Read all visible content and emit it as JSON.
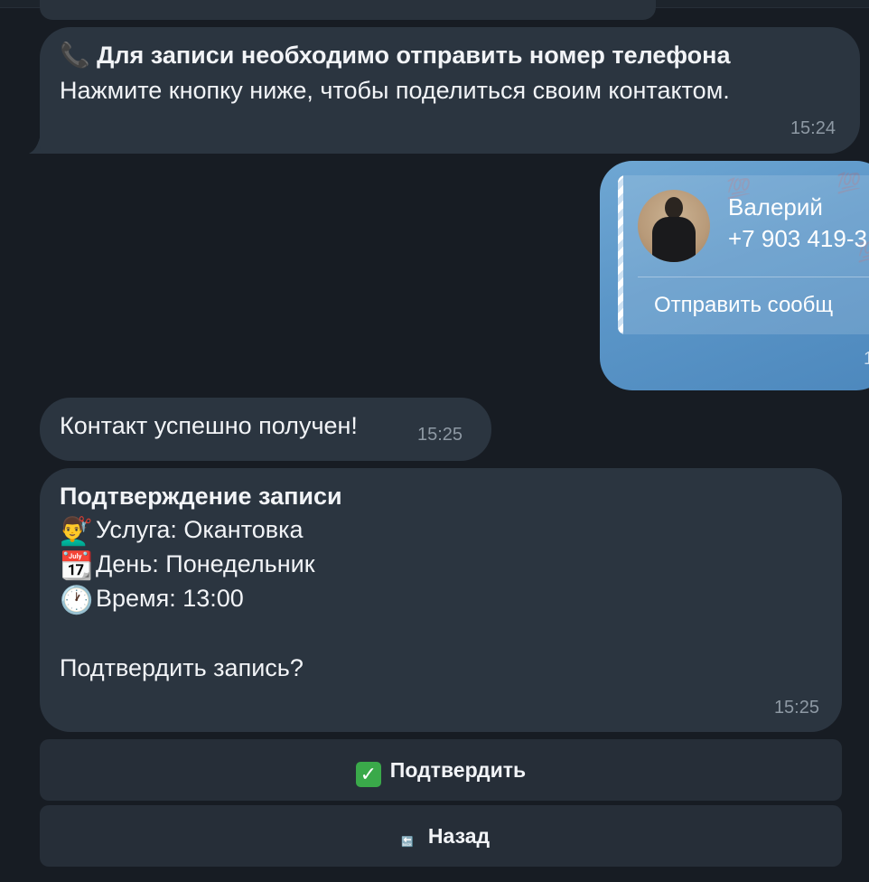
{
  "messages": {
    "phone_request": {
      "icon": "phone-receiver-icon",
      "title": "Для записи необходимо отправить номер телефона",
      "body": "Нажмите кнопку ниже, чтобы поделиться своим контактом.",
      "time": "15:24"
    },
    "shared_contact": {
      "name": "Валерий",
      "phone": "+7 903 419-3",
      "action": "Отправить сообщ",
      "time": "1"
    },
    "contact_received": {
      "text": "Контакт успешно получен!",
      "time": "15:25"
    },
    "confirmation": {
      "title": "Подтверждение записи",
      "service_icon": "barber-icon",
      "service": "Услуга: Окантовка",
      "day_icon": "calendar-icon",
      "day": "День: Понедельник",
      "time_icon": "clock-icon",
      "time_line": "Время: 13:00",
      "question": "Подтвердить запись?",
      "time": "15:25"
    }
  },
  "keyboard": {
    "confirm_icon": "check-mark-icon",
    "confirm_label": "Подтвердить",
    "back_icon": "back-arrow-icon",
    "back_label": "Назад"
  },
  "colors": {
    "background": "#171c23",
    "bubble": "#2b3540",
    "outgoing_bubble": "#5b96c8",
    "button": "#262e38",
    "timestamp": "#8e99a4"
  }
}
